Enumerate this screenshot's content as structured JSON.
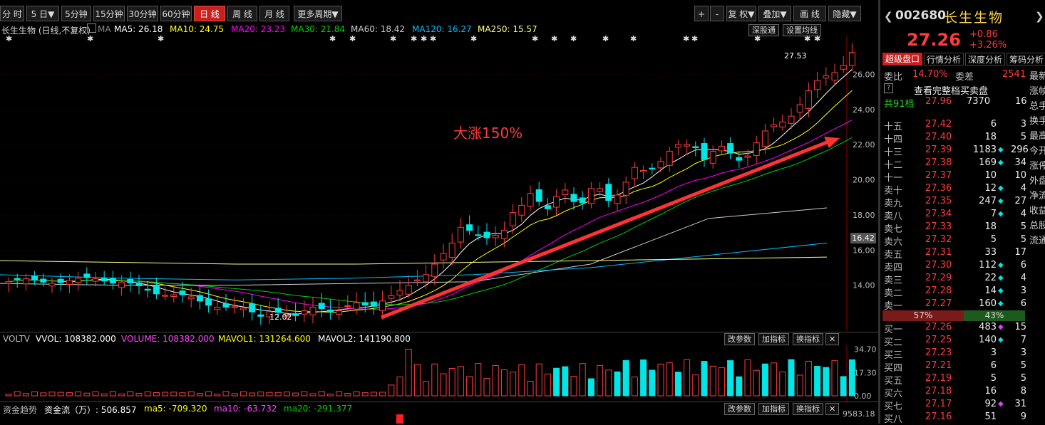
{
  "toolbar": {
    "buttons": [
      "分 时",
      "5 日▼",
      "5分钟",
      "15分钟",
      "30分钟",
      "60分钟",
      "日 线",
      "周 线",
      "月 线",
      "更多周期▼"
    ],
    "active": "日 线",
    "right_buttons": [
      "+",
      "-",
      "复 权▼",
      "叠加▼",
      "画 线",
      "隐藏▼"
    ]
  },
  "ma_bar": {
    "stock": "长生生物 (日线,不复权)",
    "ma_prefix": "MA",
    "ma5": "MA5: 26.18",
    "ma10": "MA10: 24.75",
    "ma20": "MA20: 23.23",
    "ma30": "MA30: 21.84",
    "ma60": "MA60: 18.42",
    "ma120": "MA120: 16.27",
    "ma250": "MA250: 15.57",
    "btn1": "深股通",
    "btn2": "设置均线"
  },
  "chart_data": [
    {
      "type": "candlestick",
      "ylim": [
        12.0,
        27.8
      ],
      "yticks": [
        14.0,
        16.0,
        18.0,
        20.0,
        22.0,
        24.0,
        26.0
      ],
      "ytick_labels": [
        "14.00",
        "16.00",
        "18.00",
        "20.00",
        "22.00",
        "24.00",
        "26.00"
      ],
      "current_price_label": "16.42",
      "high_label": "27.53",
      "low_label": "12.02",
      "annotation": "大涨150%",
      "series": [
        {
          "name": "MA5",
          "color": "#ffffff"
        },
        {
          "name": "MA10",
          "color": "#ffff00"
        },
        {
          "name": "MA20",
          "color": "#ff00ff"
        },
        {
          "name": "MA30",
          "color": "#00d000"
        },
        {
          "name": "MA60",
          "color": "#cccccc"
        },
        {
          "name": "MA120",
          "color": "#00bfff"
        },
        {
          "name": "MA250",
          "color": "#ffff88"
        }
      ]
    },
    {
      "type": "bar",
      "ylim": [
        0,
        36
      ],
      "ytick_labels": [
        "34.70",
        "17.30",
        "0.00"
      ],
      "unit": "万"
    }
  ],
  "vol_bar": {
    "title": "VOLTV",
    "vvol": "VVOL: 108382.000",
    "volume": "VOLUME: 108382.000",
    "mavol1": "MAVOL1: 131264.600",
    "mavol2": "MAVOL2: 141190.800",
    "btn1": "改参数",
    "btn2": "加指标",
    "btn3": "换指标"
  },
  "fund_bar": {
    "title": "资金趋势",
    "flow": "资金流（万）: 506.857",
    "ma5": "ma5: -709.320",
    "ma10": "ma10: -63.732",
    "ma20": "ma20: -291.377",
    "value": "9583.18",
    "btn1": "改参数",
    "btn2": "加指标",
    "btn3": "换指标"
  },
  "quote": {
    "code": "002680",
    "name": "长生生物",
    "price": "27.26",
    "change": "+0.86",
    "change_pct": "+3.26%",
    "tabs": [
      "超级盘口",
      "行情分析",
      "深度分析",
      "筹码分析"
    ],
    "webi_label": "委比",
    "webi": "14.70%",
    "weicha_label": "委差",
    "weicha": "2541",
    "full_book": "查看完整档买卖盘",
    "total_label": "共91档",
    "total_price": "27.96",
    "total_vol": "7370",
    "total_n": "16",
    "sell": [
      {
        "label": "十五",
        "price": "27.42",
        "vol": "6",
        "n": "3",
        "dot": ""
      },
      {
        "label": "十四",
        "price": "27.40",
        "vol": "18",
        "n": "5",
        "dot": ""
      },
      {
        "label": "十三",
        "price": "27.39",
        "vol": "1183",
        "n": "296",
        "dot": "◆"
      },
      {
        "label": "十二",
        "price": "27.38",
        "vol": "169",
        "n": "34",
        "dot": "◆"
      },
      {
        "label": "十一",
        "price": "27.37",
        "vol": "10",
        "n": "10",
        "dot": ""
      },
      {
        "label": "卖十",
        "price": "27.36",
        "vol": "12",
        "n": "4",
        "dot": "◆"
      },
      {
        "label": "卖九",
        "price": "27.35",
        "vol": "247",
        "n": "27",
        "dot": "◆"
      },
      {
        "label": "卖八",
        "price": "27.34",
        "vol": "7",
        "n": "4",
        "dot": "◆"
      },
      {
        "label": "卖七",
        "price": "27.33",
        "vol": "18",
        "n": "5",
        "dot": ""
      },
      {
        "label": "卖六",
        "price": "27.32",
        "vol": "5",
        "n": "5",
        "dot": ""
      },
      {
        "label": "卖五",
        "price": "27.31",
        "vol": "33",
        "n": "17",
        "dot": ""
      },
      {
        "label": "卖四",
        "price": "27.30",
        "vol": "112",
        "n": "6",
        "dot": "◆"
      },
      {
        "label": "卖三",
        "price": "27.29",
        "vol": "22",
        "n": "4",
        "dot": "◆"
      },
      {
        "label": "卖二",
        "price": "27.28",
        "vol": "14",
        "n": "3",
        "dot": "◆"
      },
      {
        "label": "卖一",
        "price": "27.27",
        "vol": "160",
        "n": "6",
        "dot": "◆"
      }
    ],
    "ratio_sell": "57%",
    "ratio_buy": "43%",
    "buy": [
      {
        "label": "买一",
        "price": "27.26",
        "vol": "483",
        "n": "15",
        "dot": "◆"
      },
      {
        "label": "买二",
        "price": "27.25",
        "vol": "140",
        "n": "7",
        "dot": "◆"
      },
      {
        "label": "买三",
        "price": "27.23",
        "vol": "3",
        "n": "3",
        "dot": ""
      },
      {
        "label": "买四",
        "price": "27.21",
        "vol": "6",
        "n": "5",
        "dot": ""
      },
      {
        "label": "买五",
        "price": "27.19",
        "vol": "5",
        "n": "5",
        "dot": ""
      },
      {
        "label": "买六",
        "price": "27.18",
        "vol": "16",
        "n": "8",
        "dot": ""
      },
      {
        "label": "买七",
        "price": "27.17",
        "vol": "92",
        "n": "31",
        "dot": "◆"
      },
      {
        "label": "买八",
        "price": "27.16",
        "vol": "51",
        "n": "9",
        "dot": ""
      }
    ],
    "side_labels": [
      "最新",
      "涨帧",
      "总手",
      "换手",
      "最高",
      "今开",
      "涨停",
      "外盘",
      "净流",
      "收益",
      "总股",
      "流通"
    ]
  }
}
